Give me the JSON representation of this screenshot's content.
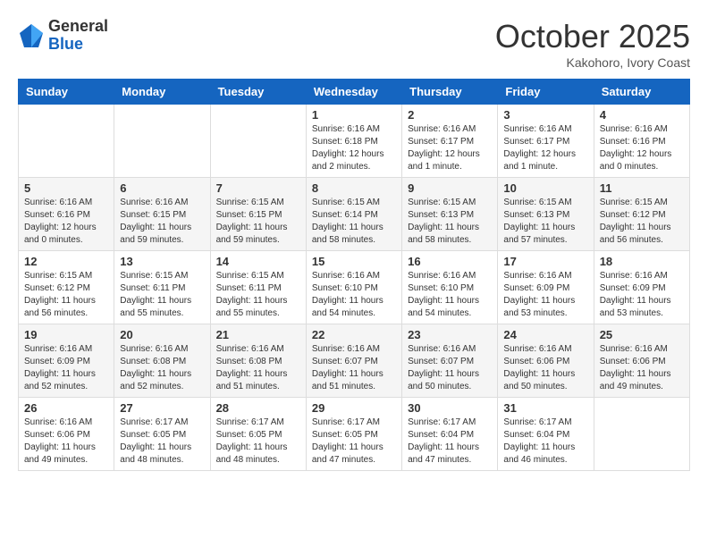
{
  "header": {
    "logo_general": "General",
    "logo_blue": "Blue",
    "month": "October 2025",
    "location": "Kakohoro, Ivory Coast"
  },
  "weekdays": [
    "Sunday",
    "Monday",
    "Tuesday",
    "Wednesday",
    "Thursday",
    "Friday",
    "Saturday"
  ],
  "weeks": [
    [
      {
        "day": "",
        "info": ""
      },
      {
        "day": "",
        "info": ""
      },
      {
        "day": "",
        "info": ""
      },
      {
        "day": "1",
        "info": "Sunrise: 6:16 AM\nSunset: 6:18 PM\nDaylight: 12 hours and 2 minutes."
      },
      {
        "day": "2",
        "info": "Sunrise: 6:16 AM\nSunset: 6:17 PM\nDaylight: 12 hours and 1 minute."
      },
      {
        "day": "3",
        "info": "Sunrise: 6:16 AM\nSunset: 6:17 PM\nDaylight: 12 hours and 1 minute."
      },
      {
        "day": "4",
        "info": "Sunrise: 6:16 AM\nSunset: 6:16 PM\nDaylight: 12 hours and 0 minutes."
      }
    ],
    [
      {
        "day": "5",
        "info": "Sunrise: 6:16 AM\nSunset: 6:16 PM\nDaylight: 12 hours and 0 minutes."
      },
      {
        "day": "6",
        "info": "Sunrise: 6:16 AM\nSunset: 6:15 PM\nDaylight: 11 hours and 59 minutes."
      },
      {
        "day": "7",
        "info": "Sunrise: 6:15 AM\nSunset: 6:15 PM\nDaylight: 11 hours and 59 minutes."
      },
      {
        "day": "8",
        "info": "Sunrise: 6:15 AM\nSunset: 6:14 PM\nDaylight: 11 hours and 58 minutes."
      },
      {
        "day": "9",
        "info": "Sunrise: 6:15 AM\nSunset: 6:13 PM\nDaylight: 11 hours and 58 minutes."
      },
      {
        "day": "10",
        "info": "Sunrise: 6:15 AM\nSunset: 6:13 PM\nDaylight: 11 hours and 57 minutes."
      },
      {
        "day": "11",
        "info": "Sunrise: 6:15 AM\nSunset: 6:12 PM\nDaylight: 11 hours and 56 minutes."
      }
    ],
    [
      {
        "day": "12",
        "info": "Sunrise: 6:15 AM\nSunset: 6:12 PM\nDaylight: 11 hours and 56 minutes."
      },
      {
        "day": "13",
        "info": "Sunrise: 6:15 AM\nSunset: 6:11 PM\nDaylight: 11 hours and 55 minutes."
      },
      {
        "day": "14",
        "info": "Sunrise: 6:15 AM\nSunset: 6:11 PM\nDaylight: 11 hours and 55 minutes."
      },
      {
        "day": "15",
        "info": "Sunrise: 6:16 AM\nSunset: 6:10 PM\nDaylight: 11 hours and 54 minutes."
      },
      {
        "day": "16",
        "info": "Sunrise: 6:16 AM\nSunset: 6:10 PM\nDaylight: 11 hours and 54 minutes."
      },
      {
        "day": "17",
        "info": "Sunrise: 6:16 AM\nSunset: 6:09 PM\nDaylight: 11 hours and 53 minutes."
      },
      {
        "day": "18",
        "info": "Sunrise: 6:16 AM\nSunset: 6:09 PM\nDaylight: 11 hours and 53 minutes."
      }
    ],
    [
      {
        "day": "19",
        "info": "Sunrise: 6:16 AM\nSunset: 6:09 PM\nDaylight: 11 hours and 52 minutes."
      },
      {
        "day": "20",
        "info": "Sunrise: 6:16 AM\nSunset: 6:08 PM\nDaylight: 11 hours and 52 minutes."
      },
      {
        "day": "21",
        "info": "Sunrise: 6:16 AM\nSunset: 6:08 PM\nDaylight: 11 hours and 51 minutes."
      },
      {
        "day": "22",
        "info": "Sunrise: 6:16 AM\nSunset: 6:07 PM\nDaylight: 11 hours and 51 minutes."
      },
      {
        "day": "23",
        "info": "Sunrise: 6:16 AM\nSunset: 6:07 PM\nDaylight: 11 hours and 50 minutes."
      },
      {
        "day": "24",
        "info": "Sunrise: 6:16 AM\nSunset: 6:06 PM\nDaylight: 11 hours and 50 minutes."
      },
      {
        "day": "25",
        "info": "Sunrise: 6:16 AM\nSunset: 6:06 PM\nDaylight: 11 hours and 49 minutes."
      }
    ],
    [
      {
        "day": "26",
        "info": "Sunrise: 6:16 AM\nSunset: 6:06 PM\nDaylight: 11 hours and 49 minutes."
      },
      {
        "day": "27",
        "info": "Sunrise: 6:17 AM\nSunset: 6:05 PM\nDaylight: 11 hours and 48 minutes."
      },
      {
        "day": "28",
        "info": "Sunrise: 6:17 AM\nSunset: 6:05 PM\nDaylight: 11 hours and 48 minutes."
      },
      {
        "day": "29",
        "info": "Sunrise: 6:17 AM\nSunset: 6:05 PM\nDaylight: 11 hours and 47 minutes."
      },
      {
        "day": "30",
        "info": "Sunrise: 6:17 AM\nSunset: 6:04 PM\nDaylight: 11 hours and 47 minutes."
      },
      {
        "day": "31",
        "info": "Sunrise: 6:17 AM\nSunset: 6:04 PM\nDaylight: 11 hours and 46 minutes."
      },
      {
        "day": "",
        "info": ""
      }
    ]
  ]
}
